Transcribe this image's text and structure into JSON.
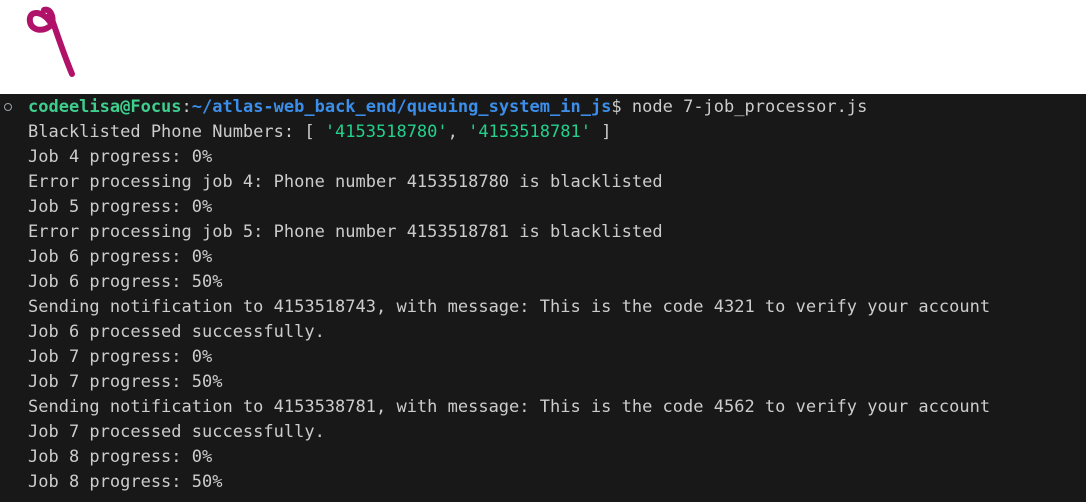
{
  "annotation": {
    "label": "9"
  },
  "terminal": {
    "prompt": {
      "user_host": "codeelisa@Focus",
      "separator": ":",
      "path": "~/atlas-web_back_end/queuing_system_in_js",
      "dollar": "$",
      "command": " node 7-job_processor.js"
    },
    "blacklist": {
      "prefix": "Blacklisted Phone Numbers: [ ",
      "number_1": "'4153518780'",
      "comma": ", ",
      "number_2": "'4153518781'",
      "suffix": " ]"
    },
    "lines": [
      "Job 4 progress: 0%",
      "Error processing job 4: Phone number 4153518780 is blacklisted",
      "Job 5 progress: 0%",
      "Error processing job 5: Phone number 4153518781 is blacklisted",
      "Job 6 progress: 0%",
      "Job 6 progress: 50%",
      "Sending notification to 4153518743, with message: This is the code 4321 to verify your account",
      "Job 6 processed successfully.",
      "Job 7 progress: 0%",
      "Job 7 progress: 50%",
      "Sending notification to 4153538781, with message: This is the code 4562 to verify your account",
      "Job 7 processed successfully.",
      "Job 8 progress: 0%",
      "Job 8 progress: 50%"
    ]
  }
}
